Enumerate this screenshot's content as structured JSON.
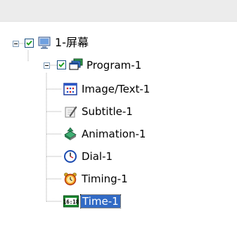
{
  "tree": {
    "screen": {
      "label": "1-屏幕",
      "icon": "monitor-icon",
      "checked": true,
      "expanded": true
    },
    "program": {
      "label": "Program-1",
      "icon": "stacked-windows-icon",
      "checked": true,
      "expanded": true
    },
    "items": [
      {
        "label": "Image/Text-1",
        "icon": "image-text-icon"
      },
      {
        "label": "Subtitle-1",
        "icon": "pencil-paper-icon"
      },
      {
        "label": "Animation-1",
        "icon": "animation-icon"
      },
      {
        "label": "Dial-1",
        "icon": "clock-dial-icon"
      },
      {
        "label": "Timing-1",
        "icon": "alarm-clock-icon"
      },
      {
        "label": "Time-1",
        "icon": "digital-clock-icon",
        "selected": true
      }
    ]
  },
  "colors": {
    "selection": "#316ac5",
    "header": "#ececec",
    "tree_line": "#a0a0a0"
  }
}
